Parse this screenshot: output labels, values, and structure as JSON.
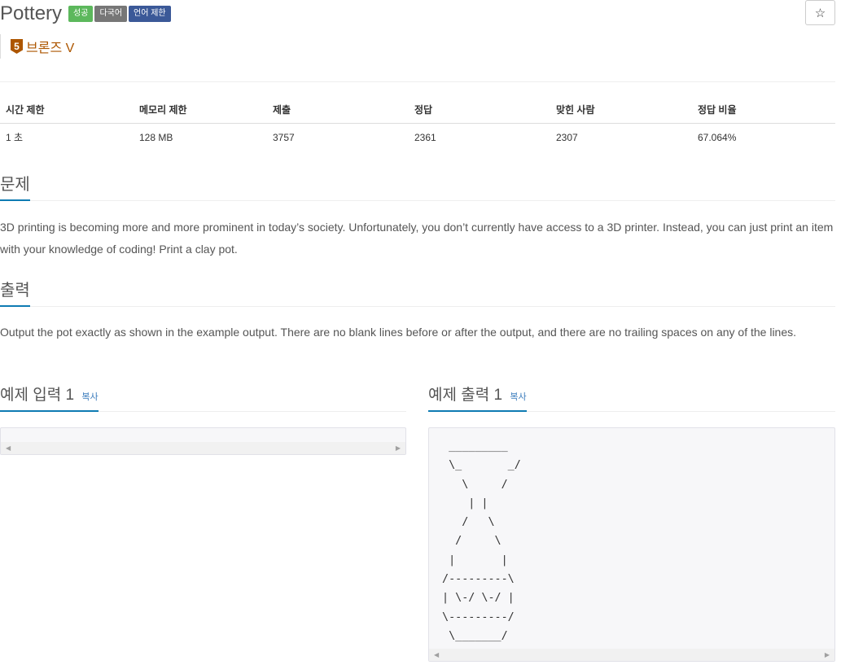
{
  "problem": {
    "title": "Pottery",
    "labels": [
      "성공",
      "다국어",
      "언어 제한"
    ],
    "tier_number": "5",
    "tier_name": "브론즈 V",
    "star_icon": "☆"
  },
  "info_table": {
    "headers": [
      "시간 제한",
      "메모리 제한",
      "제출",
      "정답",
      "맞힌 사람",
      "정답 비율"
    ],
    "values": [
      "1 초",
      "128 MB",
      "3757",
      "2361",
      "2307",
      "67.064%"
    ]
  },
  "sections": {
    "problem_heading": "문제",
    "problem_text": "3D printing is becoming more and more prominent in today’s society. Unfortunately, you don’t currently have access to a 3D printer. Instead, you can just print an item with your knowledge of coding! Print a clay pot.",
    "output_heading": "출력",
    "output_text": "Output the pot exactly as shown in the example output. There are no blank lines before or after the output, and there are no trailing spaces on any of the lines."
  },
  "samples": {
    "input_heading": "예제 입력 1",
    "output_heading": "예제 출력 1",
    "copy_label": "복사",
    "input_text": "",
    "output_text": "  _________\n  \\_       _/\n    \\     /\n     | |\n    /   \\\n   /     \\\n  |       |\n /---------\\\n | \\-/ \\-/ |\n \\---------/\n  \\_______/",
    "scroll_left": "◀",
    "scroll_right": "▶"
  }
}
